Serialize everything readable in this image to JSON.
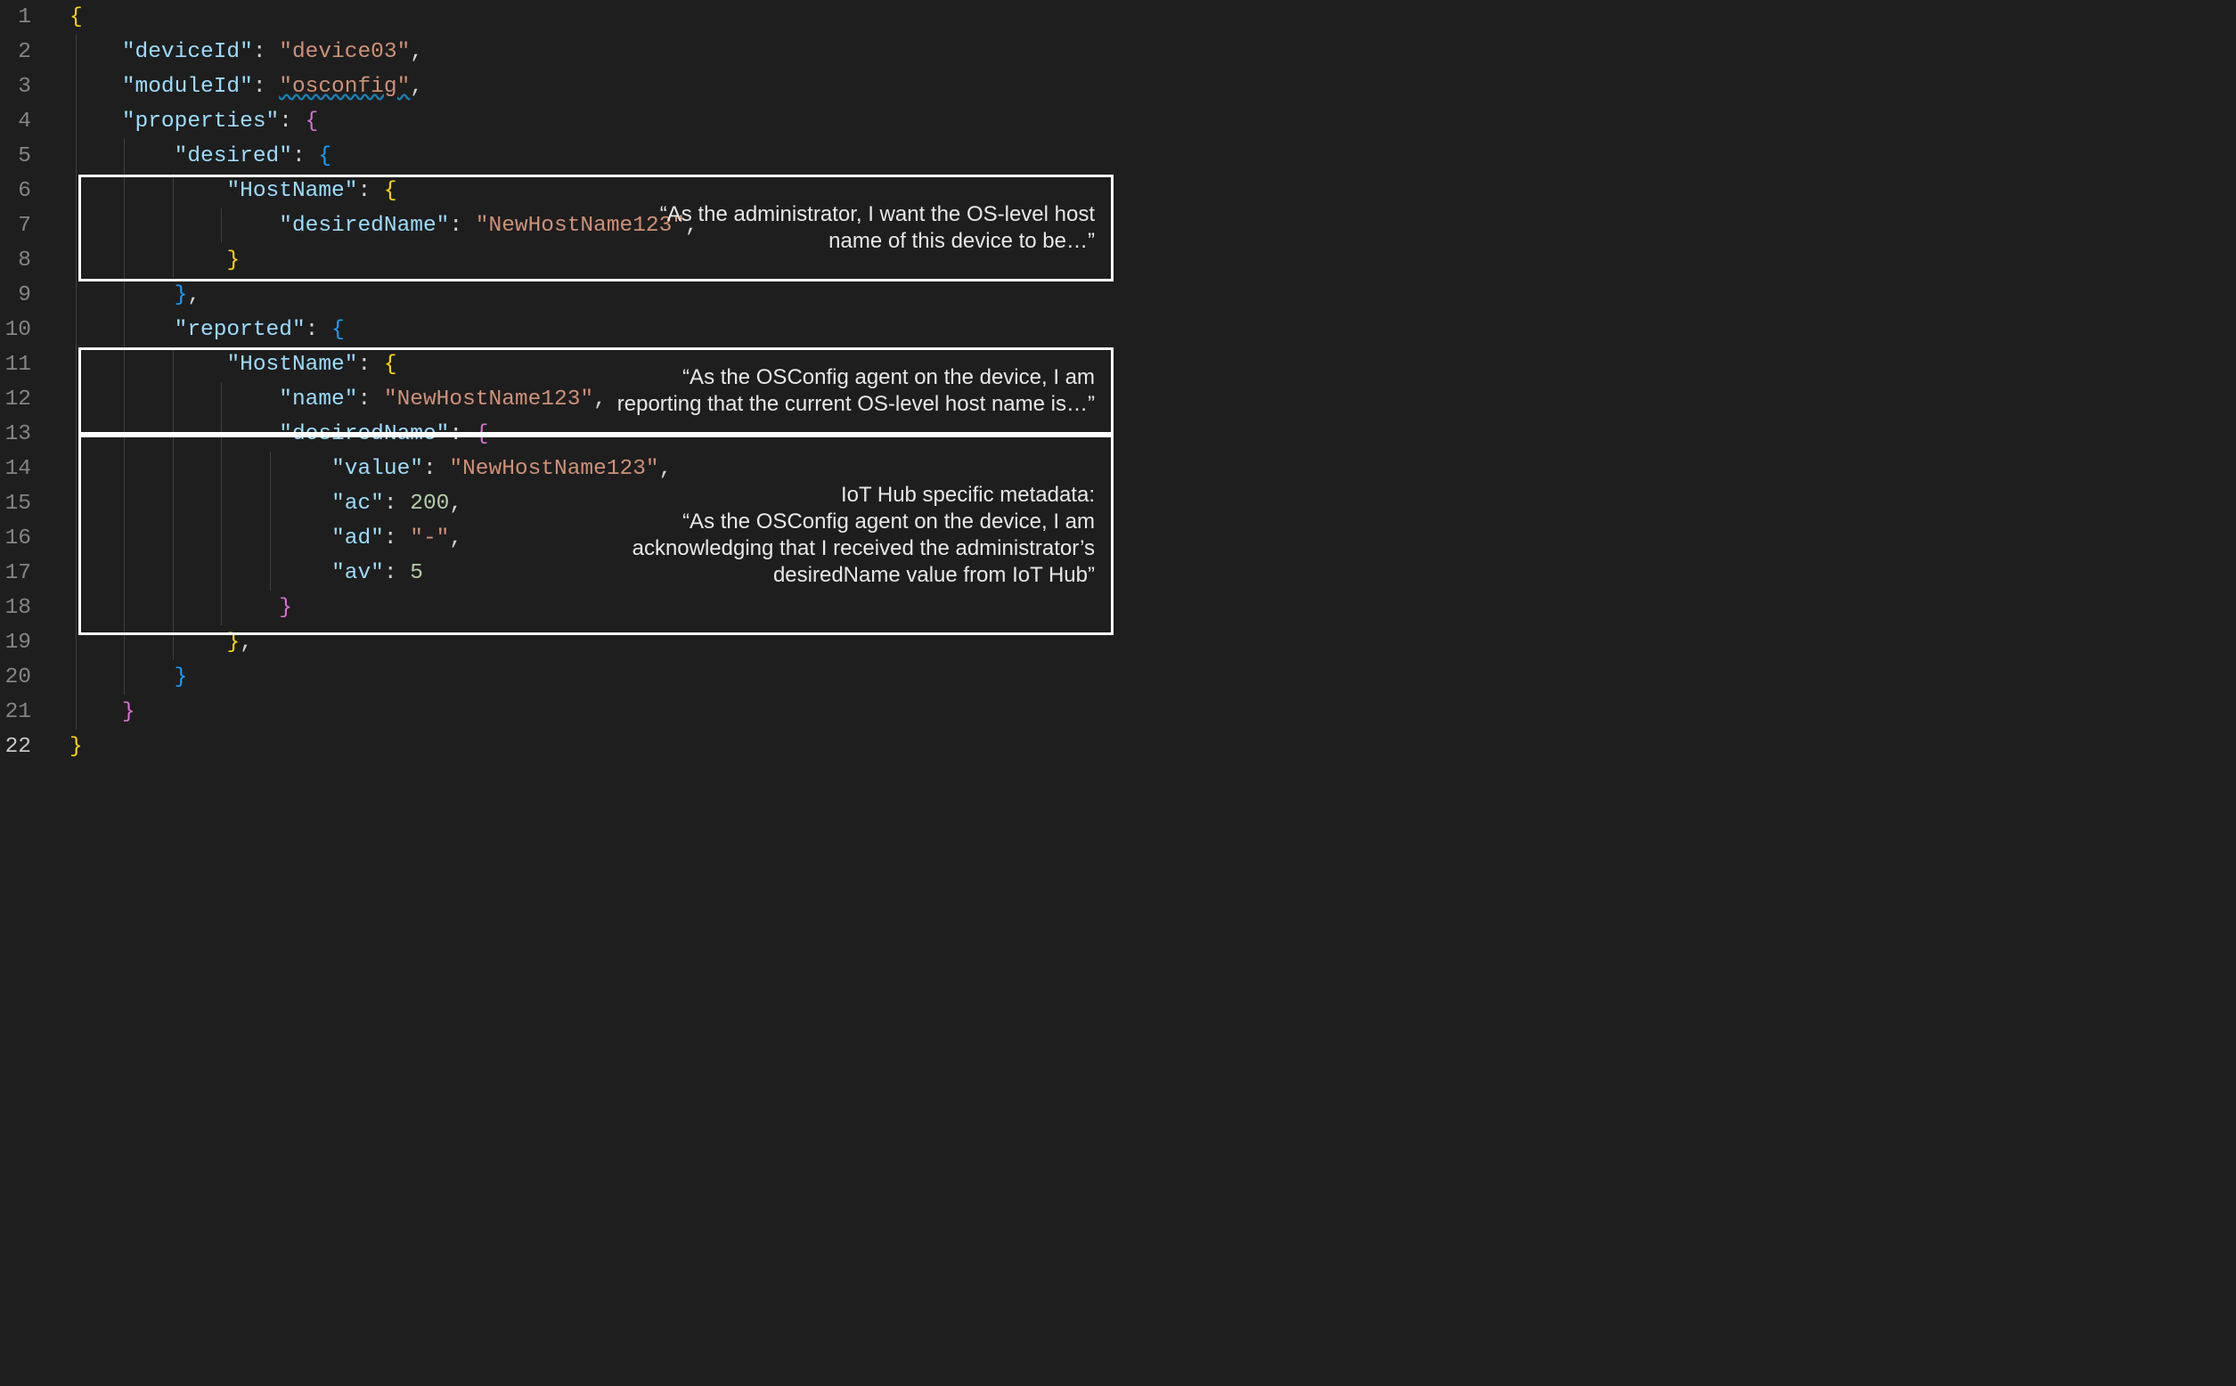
{
  "gutter": {
    "lines": [
      "1",
      "2",
      "3",
      "4",
      "5",
      "6",
      "7",
      "8",
      "9",
      "10",
      "11",
      "12",
      "13",
      "14",
      "15",
      "16",
      "17",
      "18",
      "19",
      "20",
      "21",
      "22"
    ],
    "activeLine": 22
  },
  "code": {
    "l1_brace": "{",
    "l2_key": "\"deviceId\"",
    "l2_colon": ": ",
    "l2_val": "\"device03\"",
    "l2_comma": ",",
    "l3_key": "\"moduleId\"",
    "l3_colon": ": ",
    "l3_val": "\"osconfig\"",
    "l3_comma": ",",
    "l4_key": "\"properties\"",
    "l4_colon": ": ",
    "l4_brace": "{",
    "l5_key": "\"desired\"",
    "l5_colon": ": ",
    "l5_brace": "{",
    "l6_key": "\"HostName\"",
    "l6_colon": ": ",
    "l6_brace": "{",
    "l7_key": "\"desiredName\"",
    "l7_colon": ": ",
    "l7_val": "\"NewHostName123\"",
    "l7_comma": ",",
    "l8_brace": "}",
    "l9_brace": "}",
    "l9_comma": ",",
    "l10_key": "\"reported\"",
    "l10_colon": ": ",
    "l10_brace": "{",
    "l11_key": "\"HostName\"",
    "l11_colon": ": ",
    "l11_brace": "{",
    "l12_key": "\"name\"",
    "l12_colon": ": ",
    "l12_val": "\"NewHostName123\"",
    "l12_comma": ",",
    "l13_key": "\"desiredName\"",
    "l13_colon": ": ",
    "l13_brace": "{",
    "l14_key": "\"value\"",
    "l14_colon": ": ",
    "l14_val": "\"NewHostName123\"",
    "l14_comma": ",",
    "l15_key": "\"ac\"",
    "l15_colon": ": ",
    "l15_val": "200",
    "l15_comma": ",",
    "l16_key": "\"ad\"",
    "l16_colon": ": ",
    "l16_val": "\"-\"",
    "l16_comma": ",",
    "l17_key": "\"av\"",
    "l17_colon": ": ",
    "l17_val": "5",
    "l18_brace": "}",
    "l19_brace": "}",
    "l19_comma": ",",
    "l20_brace": "}",
    "l21_brace": "}",
    "l22_brace": "}"
  },
  "annotations": {
    "a1": "“As the administrator, I want the OS-level host name of this device to be…”",
    "a2": "“As the OSConfig agent on the device, I am reporting that the current OS-level host name is…”",
    "a3": "IoT Hub specific metadata:\n“As the OSConfig agent on the device, I am acknowledging that I received the administrator’s desiredName value from IoT Hub”"
  }
}
